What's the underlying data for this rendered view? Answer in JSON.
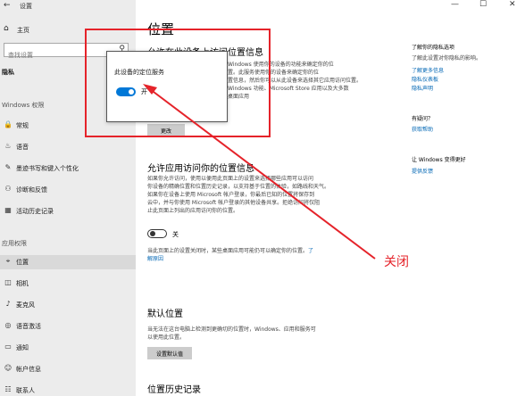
{
  "window": {
    "title": "设置",
    "controls": [
      "—",
      "☐",
      "✕"
    ]
  },
  "sidebar": {
    "home_label": "主页",
    "search_placeholder": "查找设置",
    "category": "隐私",
    "windows_permissions_label": "Windows 权限",
    "app_permissions_label": "应用权限",
    "items": [
      {
        "label": "常规",
        "icon": "lock-icon",
        "glyph": "🔒"
      },
      {
        "label": "语音",
        "icon": "speech-icon",
        "glyph": "♨"
      },
      {
        "label": "墨迹书写和键入个性化",
        "icon": "ink-icon",
        "glyph": "✎"
      },
      {
        "label": "诊断和反馈",
        "icon": "diagnostics-icon",
        "glyph": "⚇"
      },
      {
        "label": "活动历史记录",
        "icon": "history-icon",
        "glyph": "▦"
      }
    ],
    "app_items": [
      {
        "label": "位置",
        "icon": "location-icon",
        "glyph": "⌖"
      },
      {
        "label": "相机",
        "icon": "camera-icon",
        "glyph": "◫"
      },
      {
        "label": "麦克风",
        "icon": "microphone-icon",
        "glyph": "♪"
      },
      {
        "label": "语音激活",
        "icon": "voice-activation-icon",
        "glyph": "◎"
      },
      {
        "label": "通知",
        "icon": "notification-icon",
        "glyph": "▭"
      },
      {
        "label": "帐户信息",
        "icon": "account-icon",
        "glyph": "☺"
      },
      {
        "label": "联系人",
        "icon": "contacts-icon",
        "glyph": "☷"
      }
    ]
  },
  "main": {
    "title": "位置",
    "section1": {
      "heading": "允许在此设备上访问位置信息",
      "line1": "Windows 使用你的设备的功能来确定你的位",
      "line2": "置。此服务使用你的设备来确定你的位",
      "line3": "置信息，然后你可以从此设备来选择其它应用访问位置。",
      "line4": "Windows 功能、Microsoft Store 应用以及大多数",
      "line5": "桌面应用",
      "change_button": "更改"
    },
    "popup": {
      "label": "此设备的定位服务",
      "toggle_state": "开",
      "toggle_on": true
    },
    "section2": {
      "heading": "允许应用访问你的位置信息",
      "line1": "如果你允许访问，使用以便用此页面上的设置来选择哪些应用可以访问",
      "line2": "你设备的精确位置和位置历史记录，以支持基于位置的体验，如路线和天气。",
      "line3": "如果你在设备上使用 Microsoft 帐户登录，你最后已知的位置将保存到",
      "line4": "云中，并与你使用 Microsoft 帐户登录的其他设备共享。拒绝访问将仅阻",
      "line5": "止此页面上列出的应用访问你的位置。",
      "toggle_state": "关",
      "toggle_on": false,
      "note_line1": "当此页面上的设置关闭时，某些桌面应用可能仍可以确定你的位置。",
      "note_link1": "了",
      "note_link2": "解原因"
    },
    "section3": {
      "heading": "默认位置",
      "line1": "当无法在这台电脑上检测到更确切的位置时，Windows、应用和服务可",
      "line2": "以使用此位置。",
      "button": "设置默认值"
    },
    "section4": {
      "heading": "位置历史记录"
    }
  },
  "right_column": {
    "privacy_heading": "了解你的隐私选项",
    "privacy_sub": "了解此设置对你隐私的影响。",
    "links": [
      "了解更多信息",
      "隐私仪表板",
      "隐私声明"
    ],
    "question_heading": "有疑问？",
    "help_link": "获取帮助",
    "improve_heading": "让 Windows 变得更好",
    "feedback_link": "提供反馈"
  },
  "annotation": {
    "label": "关闭",
    "color": "#e5232a"
  },
  "colors": {
    "accent": "#0078d7",
    "link": "#0066b4",
    "sidebar_bg": "#ececec"
  }
}
